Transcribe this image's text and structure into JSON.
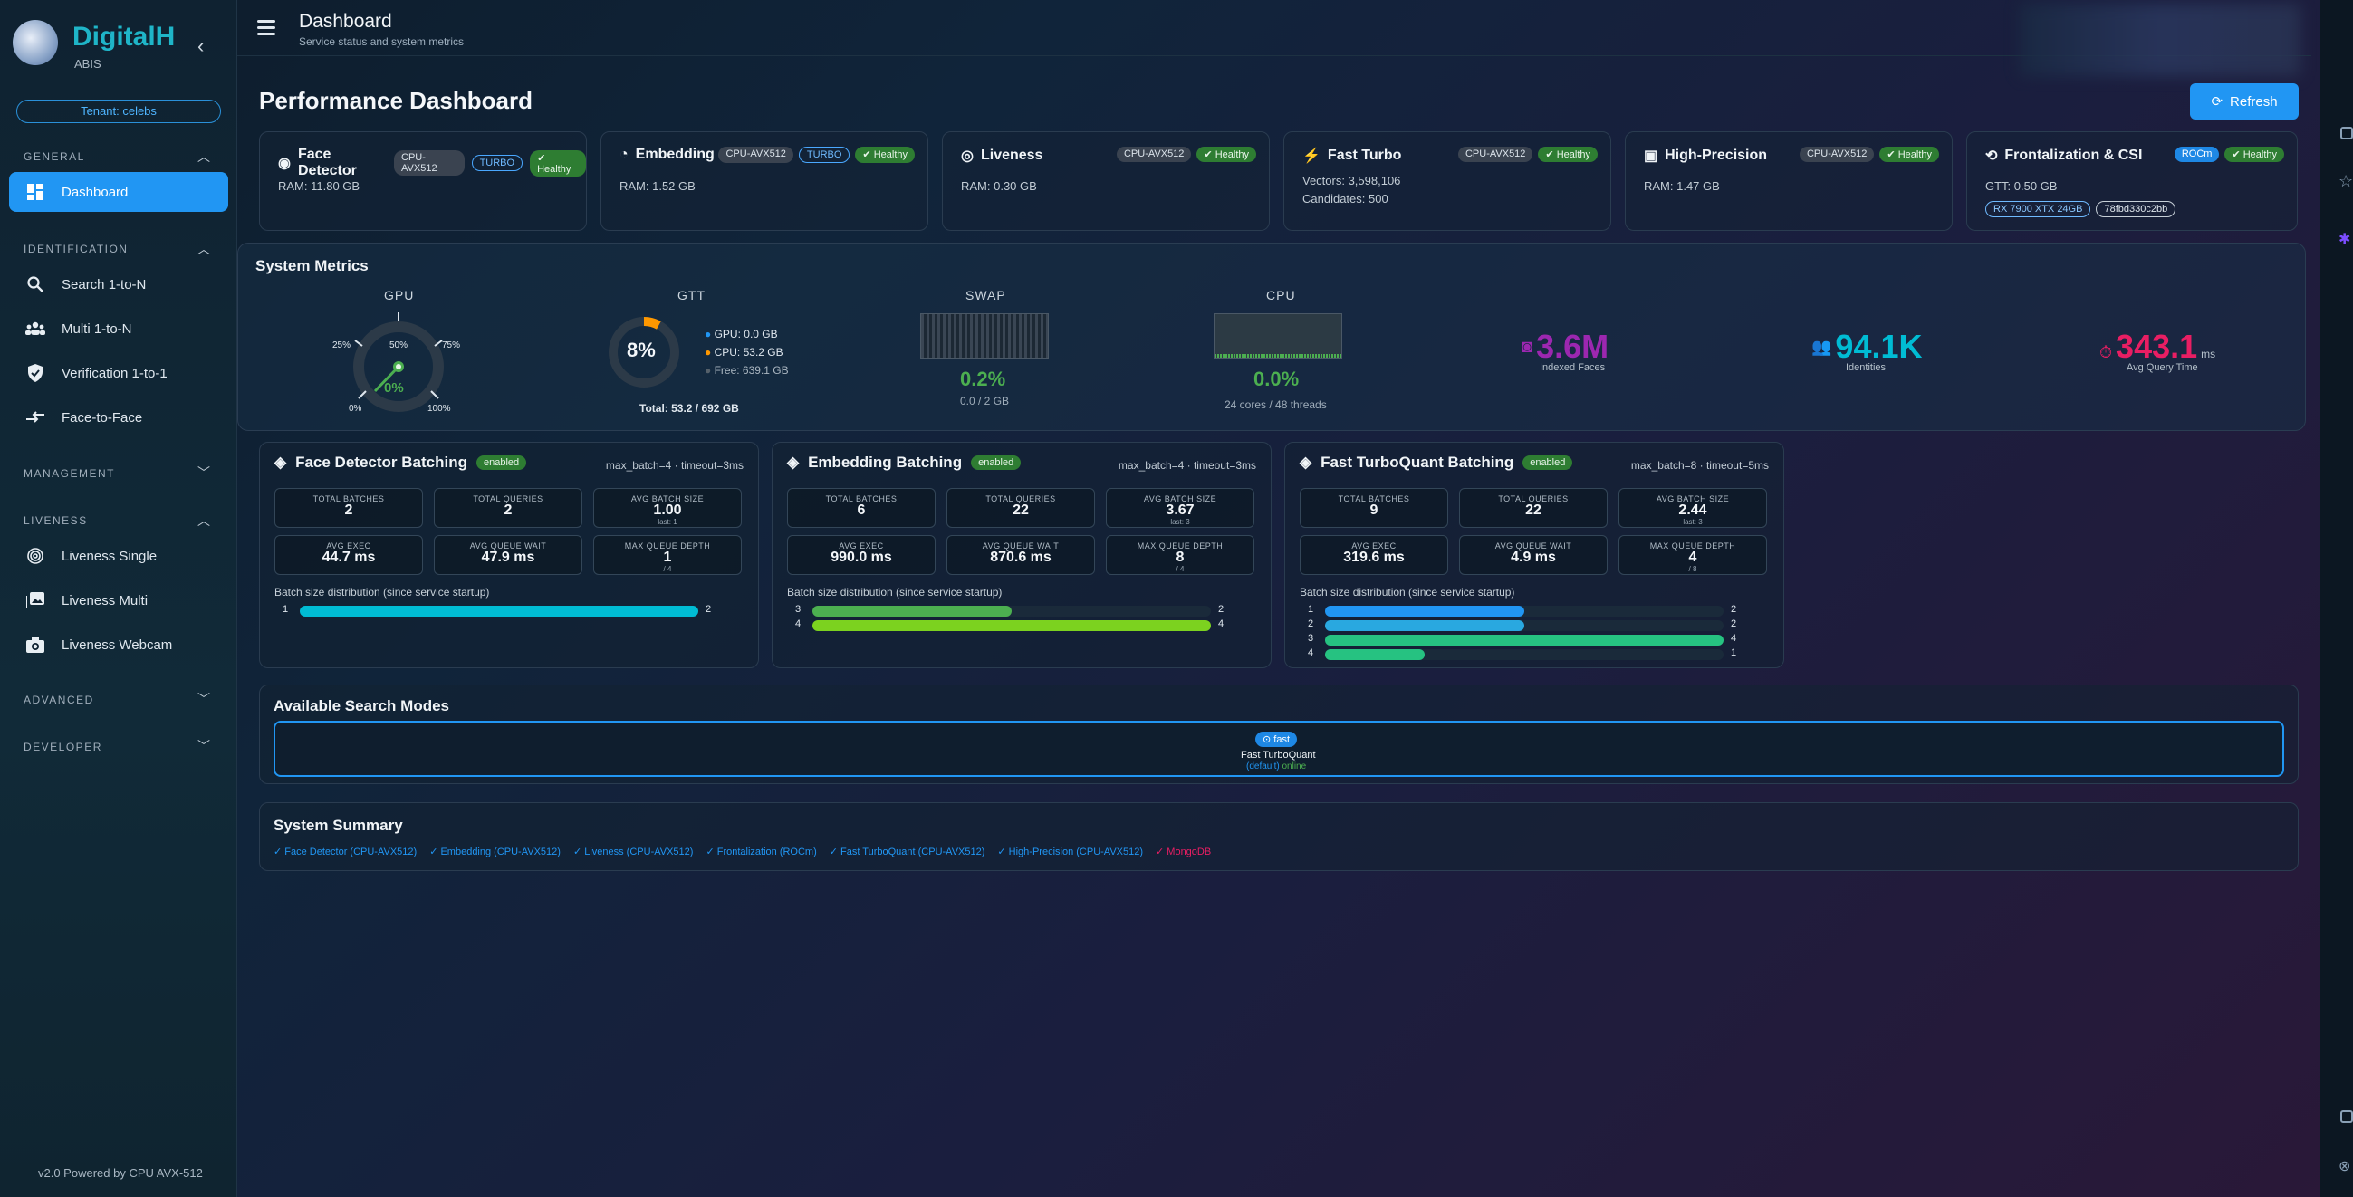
{
  "sidebar": {
    "brand": "DigitalH",
    "brand_sub": "ABIS",
    "tenant": "Tenant: celebs",
    "sections": {
      "general": "GENERAL",
      "identification": "IDENTIFICATION",
      "management": "MANAGEMENT",
      "liveness": "LIVENESS",
      "advanced": "ADVANCED",
      "developer": "DEVELOPER"
    },
    "items": [
      {
        "label": "Dashboard",
        "icon": "dashboard-icon"
      },
      {
        "label": "Search 1-to-N",
        "icon": "search-icon"
      },
      {
        "label": "Multi 1-to-N",
        "icon": "group-icon"
      },
      {
        "label": "Verification 1-to-1",
        "icon": "shield-check-icon"
      },
      {
        "label": "Face-to-Face",
        "icon": "compare-arrows-icon"
      },
      {
        "label": "Liveness Single",
        "icon": "fingerprint-icon"
      },
      {
        "label": "Liveness Multi",
        "icon": "photo-library-icon"
      },
      {
        "label": "Liveness Webcam",
        "icon": "camera-icon"
      }
    ],
    "footer": "v2.0 Powered by CPU AVX-512"
  },
  "header": {
    "title": "Dashboard",
    "subtitle": "Service status and system metrics"
  },
  "page": {
    "title": "Performance Dashboard",
    "refresh": "Refresh"
  },
  "services": [
    {
      "name": "Face Detector",
      "badges": [
        "CPU-AVX512",
        "TURBO"
      ],
      "status": "Healthy",
      "lines": [
        "RAM: 11.80 GB"
      ]
    },
    {
      "name": "Embedding",
      "badges": [
        "CPU-AVX512",
        "TURBO"
      ],
      "status": "Healthy",
      "lines": [
        "RAM: 1.52 GB"
      ]
    },
    {
      "name": "Liveness",
      "badges": [
        "CPU-AVX512"
      ],
      "status": "Healthy",
      "lines": [
        "RAM: 0.30 GB"
      ]
    },
    {
      "name": "Fast Turbo",
      "badges": [
        "CPU-AVX512"
      ],
      "status": "Healthy",
      "lines": [
        "Vectors: 3,598,106",
        "Candidates: 500"
      ]
    },
    {
      "name": "High-Precision",
      "badges": [
        "CPU-AVX512"
      ],
      "status": "Healthy",
      "lines": [
        "RAM: 1.47 GB"
      ]
    },
    {
      "name": "Frontalization & CSI",
      "badges": [
        "ROCm"
      ],
      "status": "Healthy",
      "lines": [
        "GTT: 0.50 GB"
      ],
      "tags": [
        "RX 7900 XTX 24GB",
        "78fbd330c2bb"
      ]
    }
  ],
  "metrics": {
    "title": "System Metrics",
    "gpu": {
      "label": "GPU",
      "value": "0%",
      "ticks": [
        "25%",
        "50%",
        "75%",
        "0%",
        "100%"
      ],
      "level": 0
    },
    "gtt": {
      "label": "GTT",
      "value": "8%",
      "level": 0.08,
      "gpu": "GPU: 0.0 GB",
      "cpu": "CPU: 53.2 GB",
      "free": "Free: 639.1 GB",
      "total": "Total: 53.2 / 692 GB"
    },
    "swap": {
      "label": "SWAP",
      "value": "0.2%",
      "detail": "0.0 / 2 GB"
    },
    "cpu": {
      "label": "CPU",
      "value": "0.0%",
      "detail": "24 cores / 48 threads"
    },
    "indexed": {
      "value": "3.6M",
      "label": "Indexed Faces",
      "color": "#9c27b0"
    },
    "identities": {
      "value": "94.1K",
      "label": "Identities",
      "color": "#00bcd4"
    },
    "query": {
      "value": "343.1",
      "unit": "ms",
      "label": "Avg Query Time",
      "color": "#e91e63"
    }
  },
  "batching": [
    {
      "title": "Face Detector Batching",
      "status": "enabled",
      "config": "max_batch=4 · timeout=3ms",
      "cells": [
        {
          "label": "TOTAL BATCHES",
          "value": "2",
          "sub": ""
        },
        {
          "label": "TOTAL QUERIES",
          "value": "2",
          "sub": ""
        },
        {
          "label": "AVG BATCH SIZE",
          "value": "1.00",
          "sub": "last: 1"
        },
        {
          "label": "AVG EXEC",
          "value": "44.7 ms",
          "sub": ""
        },
        {
          "label": "AVG QUEUE WAIT",
          "value": "47.9 ms",
          "sub": ""
        },
        {
          "label": "MAX QUEUE DEPTH",
          "value": "1",
          "sub": "/ 4"
        }
      ],
      "dist_label": "Batch size distribution (since service startup)",
      "dist": [
        {
          "size": "1",
          "count": "2",
          "frac": 1.0,
          "color": "#00bcd4"
        }
      ]
    },
    {
      "title": "Embedding Batching",
      "status": "enabled",
      "config": "max_batch=4 · timeout=3ms",
      "cells": [
        {
          "label": "TOTAL BATCHES",
          "value": "6",
          "sub": ""
        },
        {
          "label": "TOTAL QUERIES",
          "value": "22",
          "sub": ""
        },
        {
          "label": "AVG BATCH SIZE",
          "value": "3.67",
          "sub": "last: 3"
        },
        {
          "label": "AVG EXEC",
          "value": "990.0 ms",
          "sub": ""
        },
        {
          "label": "AVG QUEUE WAIT",
          "value": "870.6 ms",
          "sub": ""
        },
        {
          "label": "MAX QUEUE DEPTH",
          "value": "8",
          "sub": "/ 4"
        }
      ],
      "dist_label": "Batch size distribution (since service startup)",
      "dist": [
        {
          "size": "3",
          "count": "2",
          "frac": 0.5,
          "color": "#4caf50"
        },
        {
          "size": "4",
          "count": "4",
          "frac": 1.0,
          "color": "#7cd21f"
        }
      ]
    },
    {
      "title": "Fast TurboQuant Batching",
      "status": "enabled",
      "config": "max_batch=8 · timeout=5ms",
      "cells": [
        {
          "label": "TOTAL BATCHES",
          "value": "9",
          "sub": ""
        },
        {
          "label": "TOTAL QUERIES",
          "value": "22",
          "sub": ""
        },
        {
          "label": "AVG BATCH SIZE",
          "value": "2.44",
          "sub": "last: 3"
        },
        {
          "label": "AVG EXEC",
          "value": "319.6 ms",
          "sub": ""
        },
        {
          "label": "AVG QUEUE WAIT",
          "value": "4.9 ms",
          "sub": ""
        },
        {
          "label": "MAX QUEUE DEPTH",
          "value": "4",
          "sub": "/ 8"
        }
      ],
      "dist_label": "Batch size distribution (since service startup)",
      "dist": [
        {
          "size": "1",
          "count": "2",
          "frac": 0.5,
          "color": "#2196f3"
        },
        {
          "size": "2",
          "count": "2",
          "frac": 0.5,
          "color": "#29a8e0"
        },
        {
          "size": "3",
          "count": "4",
          "frac": 1.0,
          "color": "#26c281"
        },
        {
          "size": "4",
          "count": "1",
          "frac": 0.25,
          "color": "#26c281"
        }
      ]
    }
  ],
  "modes": {
    "title": "Available Search Modes",
    "chip": "fast",
    "name": "Fast TurboQuant",
    "default": "(default)",
    "status": "online"
  },
  "summary": {
    "title": "System Summary",
    "items": [
      {
        "text": "✓ Face Detector (CPU-AVX512)",
        "color": "#2196f3"
      },
      {
        "text": "✓ Embedding (CPU-AVX512)",
        "color": "#2196f3"
      },
      {
        "text": "✓ Liveness (CPU-AVX512)",
        "color": "#2196f3"
      },
      {
        "text": "✓ Frontalization (ROCm)",
        "color": "#2196f3"
      },
      {
        "text": "✓ Fast TurboQuant (CPU-AVX512)",
        "color": "#2196f3"
      },
      {
        "text": "✓ High-Precision (CPU-AVX512)",
        "color": "#2196f3"
      },
      {
        "text": "✓ MongoDB",
        "color": "#e91e63"
      }
    ]
  }
}
